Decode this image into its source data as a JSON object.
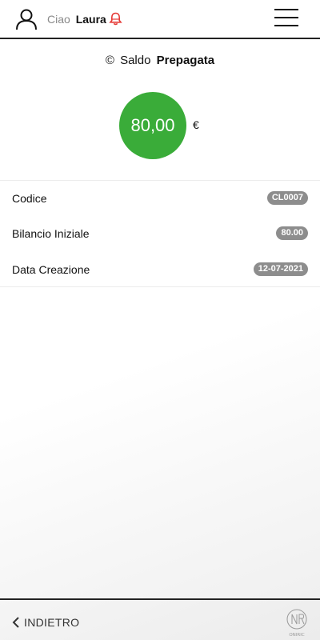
{
  "header": {
    "greeting": "Ciao",
    "user_name": "Laura",
    "user_icon": "user-icon",
    "bell_icon": "bell-icon",
    "menu_icon": "hamburger-menu-icon"
  },
  "balance": {
    "title_prefix": "Saldo",
    "title_strong": "Prepagata",
    "amount": "80,00",
    "currency": "€"
  },
  "details": [
    {
      "label": "Codice",
      "value": "CL0007"
    },
    {
      "label": "Bilancio Iniziale",
      "value": "80.00"
    },
    {
      "label": "Data Creazione",
      "value": "12-07-2021"
    }
  ],
  "footer": {
    "back_label": "INDIETRO",
    "logo_text": "ONIRIC"
  },
  "colors": {
    "accent_green": "#3aac39",
    "bell_red": "#e53935",
    "badge_gray": "#8d8d8d"
  }
}
